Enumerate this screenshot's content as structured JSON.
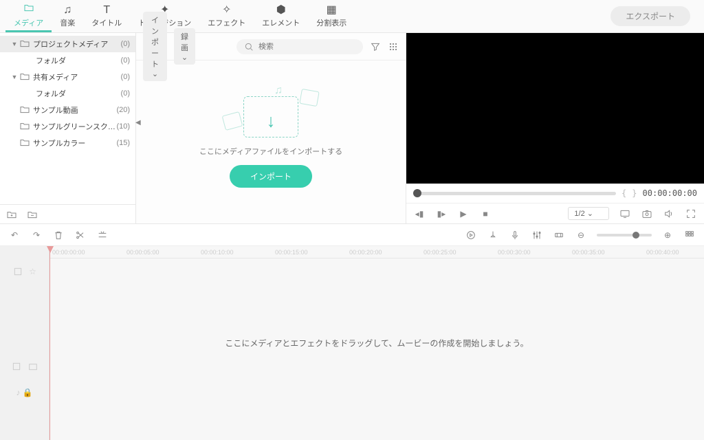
{
  "tabs": [
    {
      "label": "メディア",
      "icon": "folder",
      "active": true
    },
    {
      "label": "音楽",
      "icon": "music"
    },
    {
      "label": "タイトル",
      "icon": "text"
    },
    {
      "label": "トランジション",
      "icon": "sparkle"
    },
    {
      "label": "エフェクト",
      "icon": "wand"
    },
    {
      "label": "エレメント",
      "icon": "element"
    },
    {
      "label": "分割表示",
      "icon": "split"
    }
  ],
  "export_label": "エクスポート",
  "sidebar": {
    "items": [
      {
        "label": "プロジェクトメディア",
        "count": "(0)",
        "level": 1,
        "icon": "folder",
        "arrow": "▼",
        "active": true
      },
      {
        "label": "フォルダ",
        "count": "(0)",
        "level": 2
      },
      {
        "label": "共有メディア",
        "count": "(0)",
        "level": 1,
        "icon": "folder",
        "arrow": "▼"
      },
      {
        "label": "フォルダ",
        "count": "(0)",
        "level": 2
      },
      {
        "label": "サンプル動画",
        "count": "(20)",
        "level": 1,
        "icon": "folder"
      },
      {
        "label": "サンプルグリーンスクリーン",
        "count": "(10)",
        "level": 1,
        "icon": "folder"
      },
      {
        "label": "サンプルカラー",
        "count": "(15)",
        "level": 1,
        "icon": "folder"
      }
    ]
  },
  "content": {
    "import_drop": "インポート ⌄",
    "record_drop": "録画 ⌄",
    "search_placeholder": "検索",
    "hint": "ここにメディアファイルをインポートする",
    "import_button": "インポート"
  },
  "preview": {
    "bracket_left": "{",
    "bracket_right": "}",
    "timecode": "00:00:00:00",
    "ratio": "1/2"
  },
  "timeline": {
    "hint": "ここにメディアとエフェクトをドラッグして、ムービーの作成を開始しましょう。",
    "marks": [
      "00:00:00:00",
      "00:00:05:00",
      "00:00:10:00",
      "00:00:15:00",
      "00:00:20:00",
      "00:00:25:00",
      "00:00:30:00",
      "00:00:35:00",
      "00:00:40:00"
    ]
  }
}
